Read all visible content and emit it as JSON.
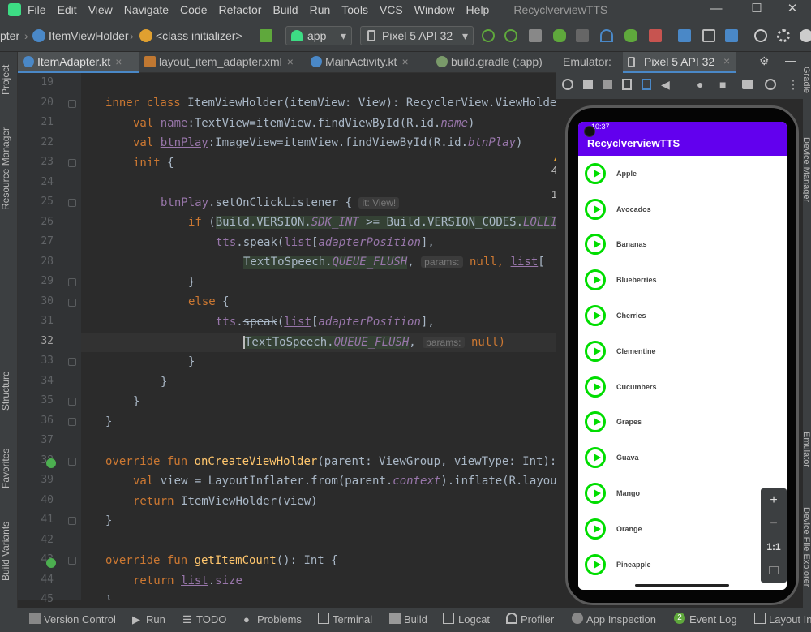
{
  "menubar": {
    "items": [
      "File",
      "Edit",
      "View",
      "Navigate",
      "Code",
      "Refactor",
      "Build",
      "Run",
      "Tools",
      "VCS",
      "Window",
      "Help"
    ],
    "title": "RecyclverviewTTS",
    "minimize": "—",
    "maximize": "☐",
    "close": "✕"
  },
  "toolbar": {
    "crumb1": "pter",
    "crumb2": "ItemViewHolder",
    "crumb3": "<class initializer>",
    "run_config": "app",
    "device": "Pixel 5 API 32"
  },
  "tabs": [
    {
      "label": "ItemAdapter.kt",
      "close": "×"
    },
    {
      "label": "layout_item_adapter.xml",
      "close": "×"
    },
    {
      "label": "MainActivity.kt",
      "close": "×"
    },
    {
      "label": "build.gradle (:app)",
      "close": ""
    }
  ],
  "inspection": {
    "warnings": "4",
    "weak": "1"
  },
  "left_tools": [
    "Project",
    "Resource Manager",
    "Structure",
    "Favorites",
    "Build Variants"
  ],
  "right_tools": [
    "Gradle",
    "Device Manager",
    "Emulator",
    "Device File Explorer"
  ],
  "line_numbers": [
    "19",
    "20",
    "21",
    "22",
    "23",
    "24",
    "25",
    "26",
    "27",
    "28",
    "29",
    "30",
    "31",
    "32",
    "33",
    "34",
    "35",
    "36",
    "37",
    "38",
    "39",
    "40",
    "41",
    "42",
    "43",
    "44",
    "45"
  ],
  "code": {
    "l20a": "inner class ",
    "l20b": "ItemViewHolder",
    "l20c": "(itemView: View): RecyclerView.ViewHolder(",
    "l21a": "val ",
    "l21b": "name",
    "l21c": ":TextView=itemView.findViewById(R.id.",
    "l21d": "name",
    "l21e": ")",
    "l22a": "val ",
    "l22b": "btnPlay",
    "l22c": ":ImageView=itemView.findViewById(R.id.",
    "l22d": "btnPlay",
    "l22e": ")",
    "l23a": "init",
    "l23b": " {",
    "l25a": "btnPlay",
    "l25b": ".setOnClickListener { ",
    "l25c": "it: View!",
    "l26a": "if",
    "l26b": " (",
    "l26c": "Build.VERSION.",
    "l26d": "SDK_INT",
    "l26e": " >= Build.VERSION_CODES.",
    "l26f": "LOLLIPOP",
    "l27a": "tts",
    "l27b": ".speak(",
    "l27c": "list",
    "l27d": "[",
    "l27e": "adapterPosition",
    "l27f": "],",
    "l28a": "TextToSpeech.",
    "l28b": "QUEUE_FLUSH",
    "l28c": ",",
    "l28d": "params:",
    "l28e": " null, ",
    "l28f": "list",
    "l28g": "[",
    "l29a": "}",
    "l30a": "else",
    "l30b": " {",
    "l31a": "tts",
    "l31b": ".",
    "l31c": "speak",
    "l31d": "(",
    "l31e": "list",
    "l31f": "[",
    "l31g": "adapterPosition",
    "l31h": "],",
    "l32a": "TextToSpeech.",
    "l32b": "QUEUE_FLUSH",
    "l32c": ",",
    "l32d": "params:",
    "l32e": " null)",
    "l33a": "}",
    "l34a": "}",
    "l35a": "}",
    "l36a": "}",
    "l38a": "override fun ",
    "l38b": "onCreateViewHolder",
    "l38c": "(parent: ViewGroup, viewType: Int): ",
    "l39a": "val ",
    "l39b": "view = LayoutInflater.from(parent.",
    "l39c": "context",
    "l39d": ").inflate(R.layout.",
    "l40a": "return ",
    "l40b": "ItemViewHolder(view)",
    "l41a": "}",
    "l43a": "override fun ",
    "l43b": "getItemCount",
    "l43c": "(): Int {",
    "l44a": "return ",
    "l44b": "list",
    "l44c": ".",
    "l44d": "size",
    "l45a": "}"
  },
  "emulator": {
    "label": "Emulator:",
    "device_tab": "Pixel 5 API 32",
    "phone": {
      "time": "10:37",
      "app_title": "RecyclverviewTTS",
      "fruits": [
        "Apple",
        "Avocados",
        "Bananas",
        "Blueberries",
        "Cherries",
        "Clementine",
        "Cucumbers",
        "Grapes",
        "Guava",
        "Mango",
        "Orange",
        "Pineapple"
      ]
    },
    "zoom": {
      "plus": "+",
      "minus": "−",
      "ratio": "1:1"
    }
  },
  "statusbar": {
    "items": [
      "Version Control",
      "Run",
      "TODO",
      "Problems",
      "Terminal",
      "Build",
      "Logcat",
      "Profiler",
      "App Inspection",
      "Event Log",
      "Layout Ins"
    ],
    "event_count": "2"
  },
  "colors": {
    "accent": "#6200ee",
    "play": "#00dd00",
    "keyword": "#cc7832",
    "function": "#ffc66d",
    "property": "#9876aa"
  }
}
